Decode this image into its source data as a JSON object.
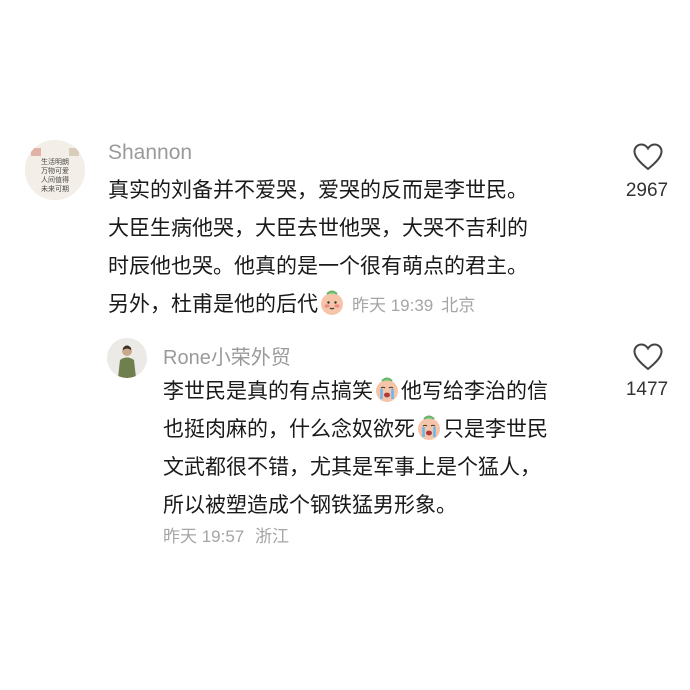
{
  "comments": [
    {
      "username": "Shannon",
      "avatar_caption": "生活明朗 万物可爱 人间值得 未来可期",
      "lines": [
        "真实的刘备并不爱哭，爱哭的反而是李世民。",
        "大臣生病他哭，大臣去世他哭，大哭不吉利的",
        "时辰他也哭。他真的是一个很有萌点的君主。"
      ],
      "last_line": "另外，杜甫是他的后代",
      "time": "昨天 19:39",
      "location": "北京",
      "likes": "2967"
    },
    {
      "username": "Rone小荣外贸",
      "line1_a": "李世民是真的有点搞笑",
      "line1_b": "他写给李治的信",
      "line2_a": "也挺肉麻的，什么念奴欲死",
      "line2_b": "只是李世民",
      "line3": "文武都很不错，尤其是军事上是个猛人，",
      "line4": "所以被塑造成个钢铁猛男形象。",
      "time": "昨天 19:57",
      "location": "浙江",
      "likes": "1477"
    }
  ],
  "icons": {
    "like": "heart-outline-icon",
    "emoji_shy": "blushing-face-icon",
    "emoji_cry": "crying-face-icon"
  },
  "colors": {
    "username": "#9a9a9a",
    "text": "#1a1a1a",
    "meta": "#a5a5a5",
    "count": "#333333"
  }
}
